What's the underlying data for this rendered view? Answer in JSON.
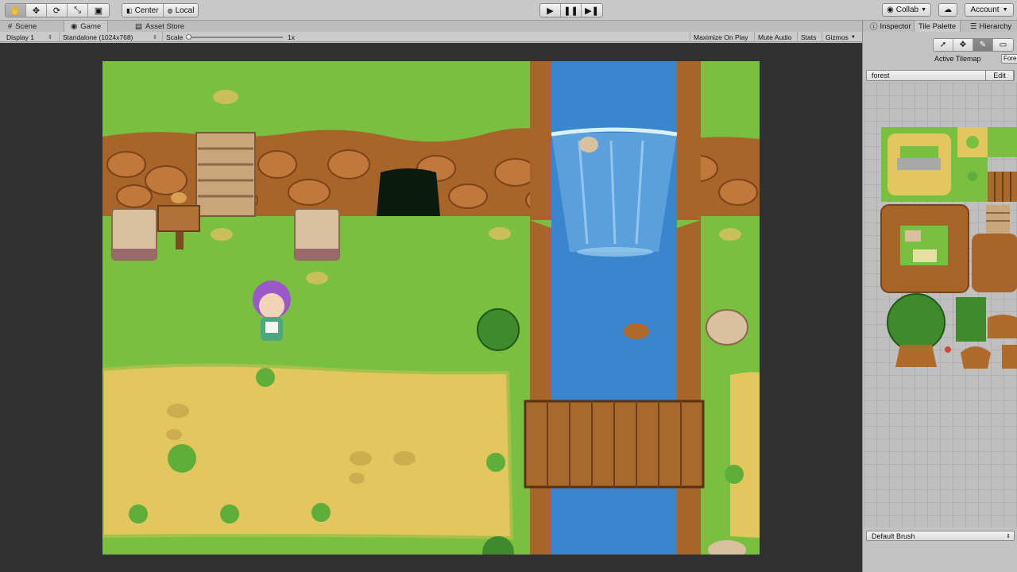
{
  "toolbar": {
    "tools": [
      "hand-icon",
      "move-icon",
      "rotate-icon",
      "scale-icon",
      "rect-icon"
    ],
    "pivot_center": "Center",
    "pivot_local": "Local",
    "collab": "Collab",
    "account": "Account"
  },
  "tabs": {
    "scene": "Scene",
    "game": "Game",
    "asset_store": "Asset Store"
  },
  "gamebar": {
    "display": "Display 1",
    "resolution": "Standalone (1024x768)",
    "scale_label": "Scale",
    "scale_value": "1x",
    "maximize": "Maximize On Play",
    "mute": "Mute Audio",
    "stats": "Stats",
    "gizmos": "Gizmos"
  },
  "rightpanel": {
    "tab_inspector": "Inspector",
    "tab_tile_palette": "Tile Palette",
    "tab_hierarchy": "Hierarchy",
    "active_tilemap_label": "Active Tilemap",
    "active_tilemap_value": "Forest",
    "palette_name": "forest",
    "edit": "Edit",
    "brush": "Default Brush"
  },
  "colors": {
    "grass": "#79c040",
    "dirt": "#b8702c",
    "water": "#3a86cc",
    "sand": "#e2c65e",
    "wood": "#a8692c"
  }
}
